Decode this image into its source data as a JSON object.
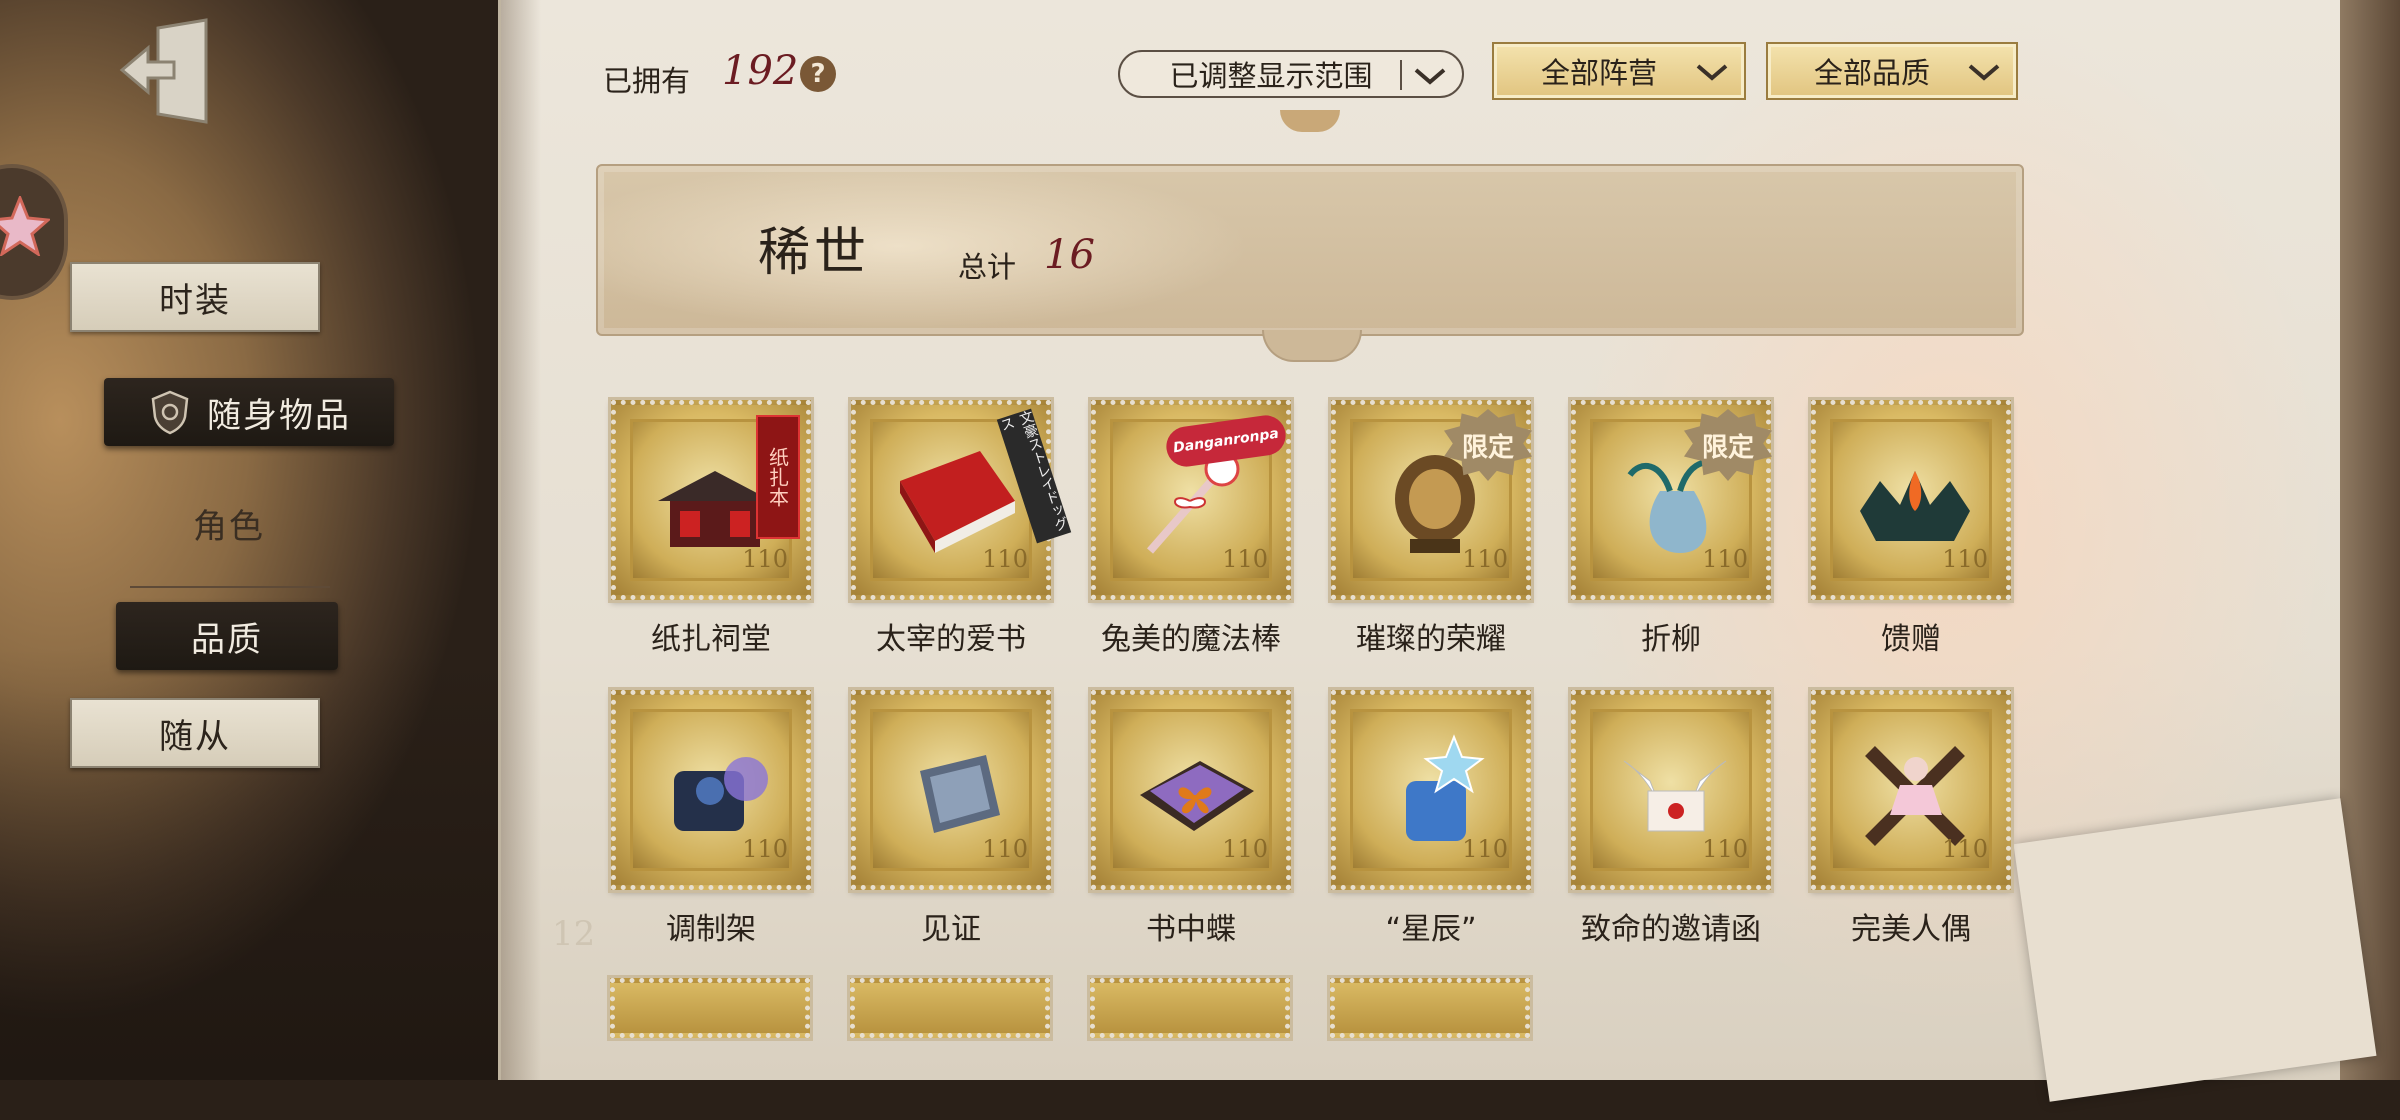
{
  "header": {
    "owned_label": "已拥有",
    "owned_count": "192",
    "help_symbol": "?",
    "filter_range": "已调整显示范围",
    "filter_camp": "全部阵营",
    "filter_quality": "全部品质"
  },
  "sidebar": {
    "items": [
      {
        "label": "时装",
        "state": "normal"
      },
      {
        "label": "随身物品",
        "state": "selected",
        "icon": "shield-icon"
      },
      {
        "label": "角色",
        "state": "plain"
      },
      {
        "label": "品质",
        "state": "selected"
      },
      {
        "label": "随从",
        "state": "normal"
      }
    ]
  },
  "category": {
    "title": "稀世",
    "total_label": "总计",
    "total": "16"
  },
  "items": [
    {
      "name": "纸扎祠堂",
      "value": "110",
      "tag": "纸扎本"
    },
    {
      "name": "太宰的爱书",
      "value": "110",
      "tag": "文豪ストレイドッグス"
    },
    {
      "name": "兔美的魔法棒",
      "value": "110",
      "tag": "Danganronpa"
    },
    {
      "name": "璀璨的荣耀",
      "value": "110",
      "tag": "限定"
    },
    {
      "name": "折柳",
      "value": "110",
      "tag": "限定"
    },
    {
      "name": "馈赠",
      "value": "110"
    },
    {
      "name": "调制架",
      "value": "110"
    },
    {
      "name": "见证",
      "value": "110"
    },
    {
      "name": "书中蝶",
      "value": "110"
    },
    {
      "name": "“星辰”",
      "value": "110"
    },
    {
      "name": "致命的邀请函",
      "value": "110"
    },
    {
      "name": "完美人偶",
      "value": "110"
    }
  ],
  "background_number": "12",
  "colors": {
    "accent_number": "#6b1c22",
    "stamp_gold": "#d9b963",
    "paper": "#ece6db",
    "dark_button": "#2d251e"
  }
}
